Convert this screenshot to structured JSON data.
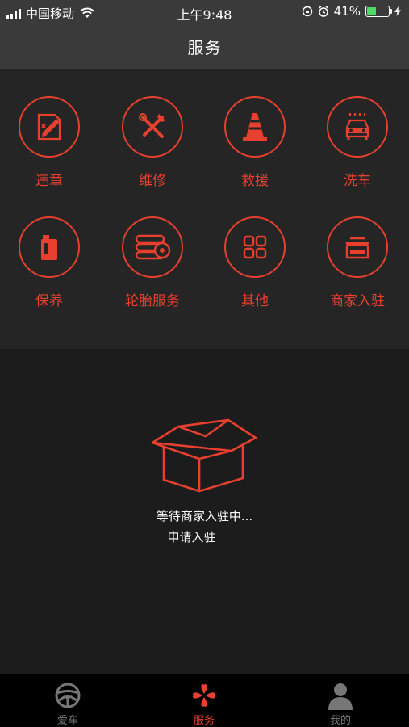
{
  "status_bar": {
    "carrier": "中国移动",
    "time": "上午9:48",
    "battery": "41%",
    "battery_level": 0.41
  },
  "header": {
    "title": "服务"
  },
  "services": [
    {
      "label": "违章",
      "icon": "violation-icon"
    },
    {
      "label": "维修",
      "icon": "repair-tools-icon"
    },
    {
      "label": "救援",
      "icon": "traffic-cone-icon"
    },
    {
      "label": "洗车",
      "icon": "car-wash-icon"
    },
    {
      "label": "保养",
      "icon": "oil-can-icon"
    },
    {
      "label": "轮胎服务",
      "icon": "tires-icon"
    },
    {
      "label": "其他",
      "icon": "grid-squares-icon"
    },
    {
      "label": "商家入驻",
      "icon": "store-icon"
    }
  ],
  "empty_state": {
    "message": "等待商家入驻中...",
    "action": "申请入驻",
    "icon": "open-box-icon"
  },
  "tab_bar": {
    "tabs": [
      {
        "label": "爱车",
        "icon": "steering-wheel-icon",
        "active": false
      },
      {
        "label": "服务",
        "icon": "clover-icon",
        "active": true
      },
      {
        "label": "我的",
        "icon": "person-icon",
        "active": false
      }
    ]
  },
  "colors": {
    "accent": "#e8402f",
    "background": "#1c1c1c",
    "panel": "#252525",
    "bar": "#3a3a3a"
  }
}
